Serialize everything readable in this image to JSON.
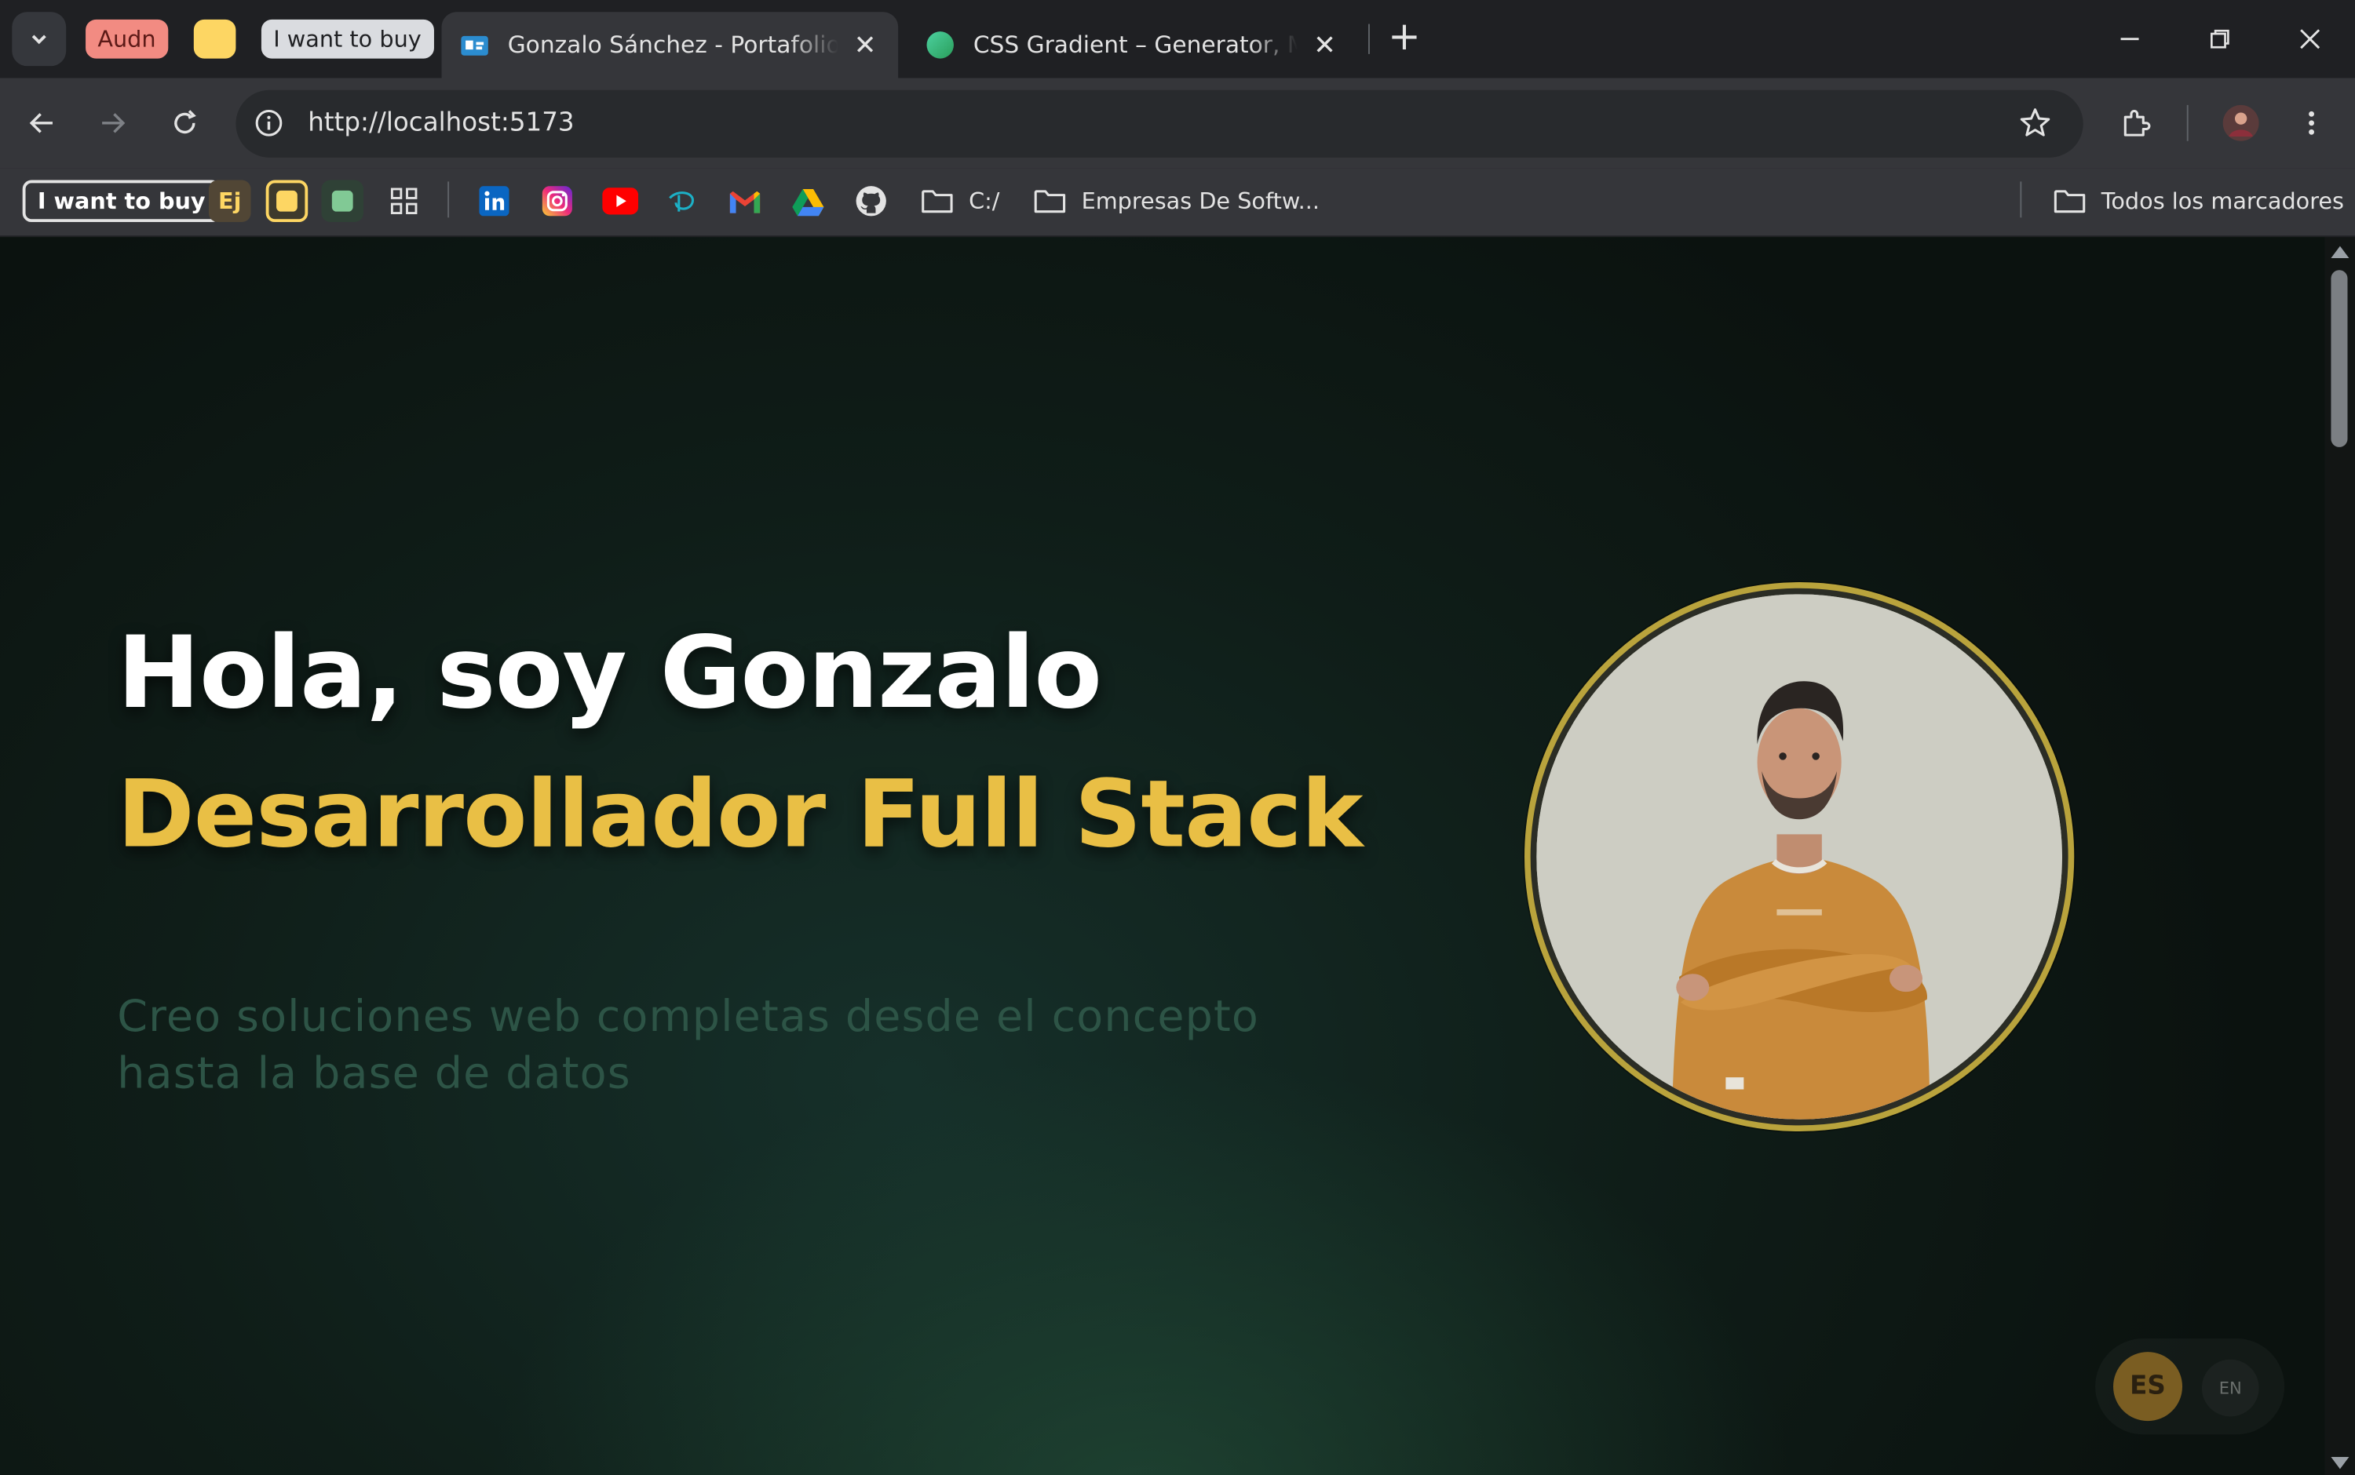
{
  "browser": {
    "tab_groups": [
      "Audn",
      "",
      "I want to buy"
    ],
    "tabs": [
      {
        "title": "Gonzalo Sánchez - Portafolio Web",
        "active": true
      },
      {
        "title": "CSS Gradient – Generator, Maker",
        "active": false
      }
    ],
    "url": "http://localhost:5173",
    "bookmarks": {
      "first": "I want to buy",
      "ej": "Ej",
      "folder_c": "C:/",
      "folder_empresas": "Empresas De Softw...",
      "all_bookmarks": "Todos los marcadores",
      "icons": [
        "apps-icon",
        "linkedin-icon",
        "instagram-icon",
        "youtube-icon",
        "disney-icon",
        "gmail-icon",
        "drive-icon",
        "github-icon"
      ]
    }
  },
  "hero": {
    "greeting": "Hola, soy Gonzalo",
    "role": "Desarrollador Full Stack",
    "description": "Creo soluciones web completas desde el concepto hasta la base de datos"
  },
  "language": {
    "es": "ES",
    "en": "EN",
    "selected": "ES"
  },
  "colors": {
    "accent": "#e9bf45",
    "background": "#0f1d18"
  }
}
